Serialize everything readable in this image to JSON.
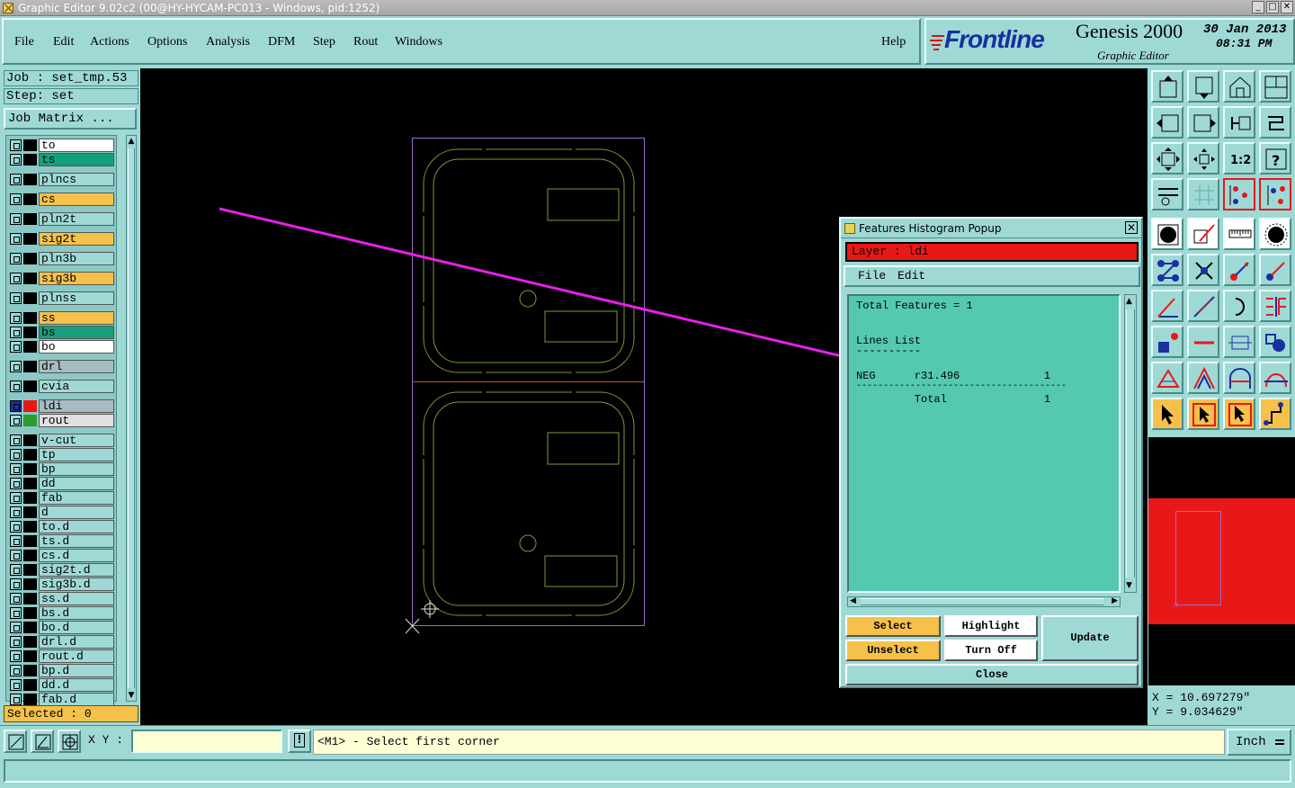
{
  "window": {
    "title": "Graphic Editor 9.02c2 (00@HY-HYCAM-PC013 - Windows, pid:1252)",
    "buttons": [
      "_",
      "□",
      "✕"
    ]
  },
  "menu": {
    "items": [
      {
        "label": "File"
      },
      {
        "label": "Edit"
      },
      {
        "label": "Actions"
      },
      {
        "label": "Options"
      },
      {
        "label": "Analysis"
      },
      {
        "label": "DFM"
      },
      {
        "label": "Step"
      },
      {
        "label": "Rout"
      },
      {
        "label": "Windows"
      }
    ],
    "help": "Help"
  },
  "brand": {
    "logo": "Frontline",
    "product": "Genesis 2000",
    "subtitle": "Graphic Editor",
    "date": "30 Jan 2013",
    "time": "08:31 PM"
  },
  "job": {
    "job_line": "Job : set_tmp.53",
    "step_line": "Step: set",
    "matrix_button": "Job Matrix ..."
  },
  "layers": [
    {
      "name": "to",
      "color": "#ffffff",
      "swatch": "#000000"
    },
    {
      "name": "ts",
      "color": "#14a07c",
      "swatch": "#000000"
    },
    {
      "name": "plncs",
      "color": "#9fd9d6",
      "swatch": "#000000"
    },
    {
      "name": "cs",
      "color": "#f5c14a",
      "swatch": "#000000"
    },
    {
      "name": "pln2t",
      "color": "#9fd9d6",
      "swatch": "#000000"
    },
    {
      "name": "sig2t",
      "color": "#f5c14a",
      "swatch": "#000000"
    },
    {
      "name": "pln3b",
      "color": "#9fd9d6",
      "swatch": "#000000"
    },
    {
      "name": "sig3b",
      "color": "#f5c14a",
      "swatch": "#000000"
    },
    {
      "name": "plnss",
      "color": "#9fd9d6",
      "swatch": "#000000"
    },
    {
      "name": "ss",
      "color": "#f5c14a",
      "swatch": "#000000"
    },
    {
      "name": "bs",
      "color": "#14a07c",
      "swatch": "#000000"
    },
    {
      "name": "bo",
      "color": "#ffffff",
      "swatch": "#000000"
    },
    {
      "name": "drl",
      "color": "#a6bcc0",
      "swatch": "#000000"
    },
    {
      "name": "cvia",
      "color": "#9fd9d6",
      "swatch": "#000000"
    },
    {
      "name": "ldi",
      "color": "#a6bcc0",
      "swatch": "#e81818",
      "active": true
    },
    {
      "name": "rout",
      "color": "#e0e0e0",
      "swatch": "#2f9a2f"
    },
    {
      "name": "v-cut",
      "color": "#9fd9d6",
      "swatch": "#000000"
    },
    {
      "name": "tp",
      "color": "#9fd9d6",
      "swatch": "#000000"
    },
    {
      "name": "bp",
      "color": "#9fd9d6",
      "swatch": "#000000"
    },
    {
      "name": "dd",
      "color": "#9fd9d6",
      "swatch": "#000000"
    },
    {
      "name": "fab",
      "color": "#9fd9d6",
      "swatch": "#000000"
    },
    {
      "name": "d",
      "color": "#9fd9d6",
      "swatch": "#000000"
    },
    {
      "name": "to.d",
      "color": "#9fd9d6",
      "swatch": "#000000"
    },
    {
      "name": "ts.d",
      "color": "#9fd9d6",
      "swatch": "#000000"
    },
    {
      "name": "cs.d",
      "color": "#9fd9d6",
      "swatch": "#000000"
    },
    {
      "name": "sig2t.d",
      "color": "#9fd9d6",
      "swatch": "#000000"
    },
    {
      "name": "sig3b.d",
      "color": "#9fd9d6",
      "swatch": "#000000"
    },
    {
      "name": "ss.d",
      "color": "#9fd9d6",
      "swatch": "#000000"
    },
    {
      "name": "bs.d",
      "color": "#9fd9d6",
      "swatch": "#000000"
    },
    {
      "name": "bo.d",
      "color": "#9fd9d6",
      "swatch": "#000000"
    },
    {
      "name": "drl.d",
      "color": "#9fd9d6",
      "swatch": "#000000"
    },
    {
      "name": "rout.d",
      "color": "#9fd9d6",
      "swatch": "#000000"
    },
    {
      "name": "bp.d",
      "color": "#9fd9d6",
      "swatch": "#000000"
    },
    {
      "name": "dd.d",
      "color": "#9fd9d6",
      "swatch": "#000000"
    },
    {
      "name": "fab.d",
      "color": "#9fd9d6",
      "swatch": "#000000"
    }
  ],
  "selected_label": "Selected : 0",
  "popup": {
    "title": "Features Histogram Popup",
    "layer_label": "Layer :  ldi",
    "menu": {
      "file": "File",
      "edit": "Edit"
    },
    "lines": {
      "total": "Total Features = 1",
      "list_title": "Lines List",
      "list_rule": "----------",
      "row": "NEG      r31.496             1",
      "rule": "---------------------------------------",
      "total_row": "         Total               1"
    },
    "buttons": {
      "select": "Select",
      "highlight": "Highlight",
      "update": "Update",
      "unselect": "Unselect",
      "turn_off": "Turn Off",
      "close": "Close"
    }
  },
  "coords": {
    "x": "X = 10.697279\"",
    "y": "Y = 9.034629\""
  },
  "bottom": {
    "xy_label": "X Y :",
    "xy_value": "",
    "prompt": "<M1> - Select first corner",
    "unit": "Inch",
    "status": ""
  },
  "colors": {
    "panel": "#9fd9d6",
    "outline_green": "#7a9a3a",
    "profile_purple": "#9a6ad0",
    "arrow_magenta": "#e81fe8",
    "active_red": "#e81818"
  }
}
